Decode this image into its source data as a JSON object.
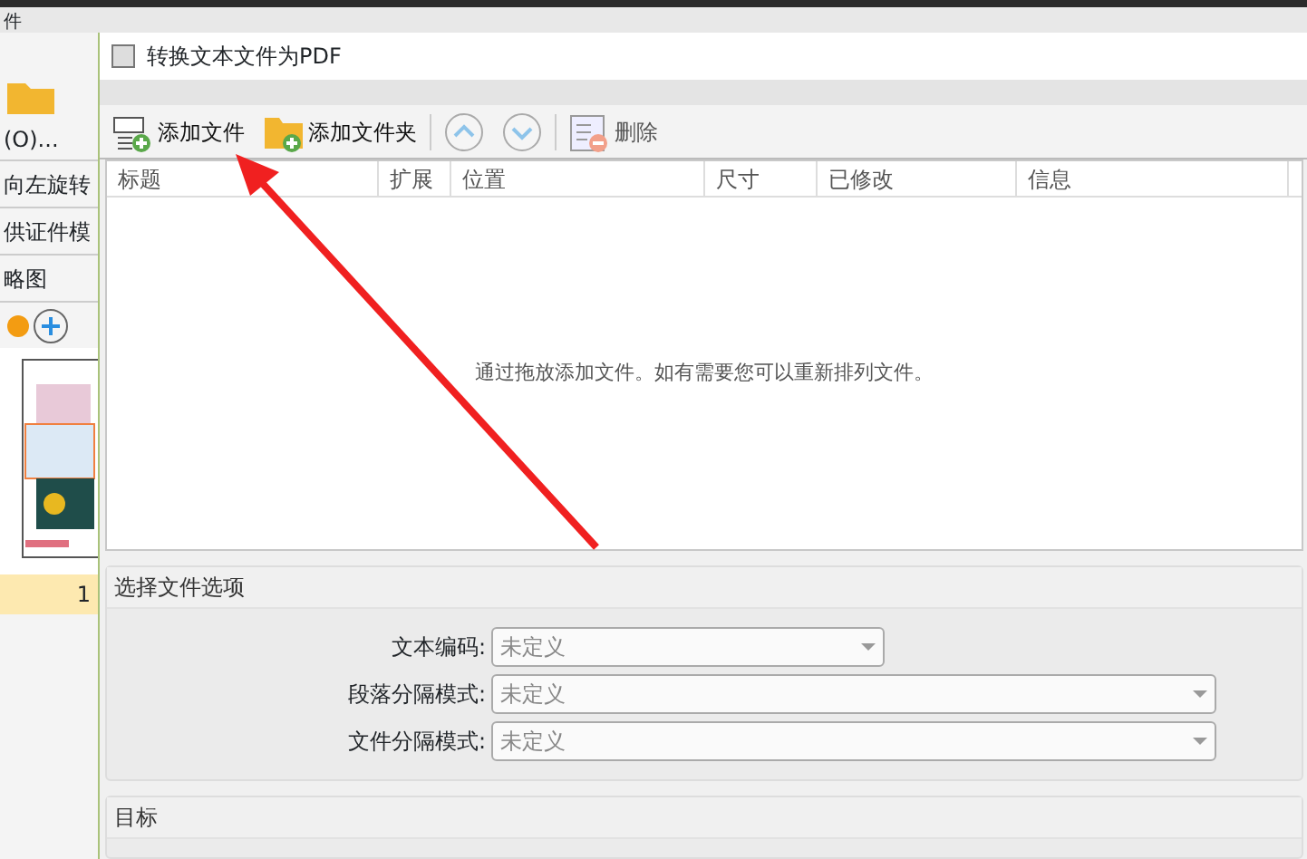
{
  "background_app": {
    "menu": [
      "件"
    ],
    "open_label": "(O)...",
    "rotate_button": "向左旋转",
    "template_label": "供证件模",
    "panel_title": "略图",
    "page_number": "1"
  },
  "dialog": {
    "title": "转换文本文件为PDF",
    "toolbar": [
      {
        "kind": "add-file",
        "label": "添加文件",
        "disabled": false
      },
      {
        "kind": "add-folder",
        "label": "添加文件夹",
        "disabled": false
      },
      {
        "kind": "up",
        "disabled": true
      },
      {
        "kind": "down",
        "disabled": true
      },
      {
        "kind": "delete",
        "label": "删除",
        "disabled": true
      }
    ],
    "table": {
      "columns": [
        "标题",
        "扩展",
        "位置",
        "尺寸",
        "已修改",
        "信息"
      ],
      "empty_message": "通过拖放添加文件。如有需要您可以重新排列文件。"
    },
    "options": {
      "title": "选择文件选项",
      "fields": [
        {
          "label": "文本编码:",
          "value": "未定义",
          "wide": false
        },
        {
          "label": "段落分隔模式:",
          "value": "未定义",
          "wide": true
        },
        {
          "label": "文件分隔模式:",
          "value": "未定义",
          "wide": true
        }
      ]
    },
    "target": {
      "title": "目标"
    }
  }
}
